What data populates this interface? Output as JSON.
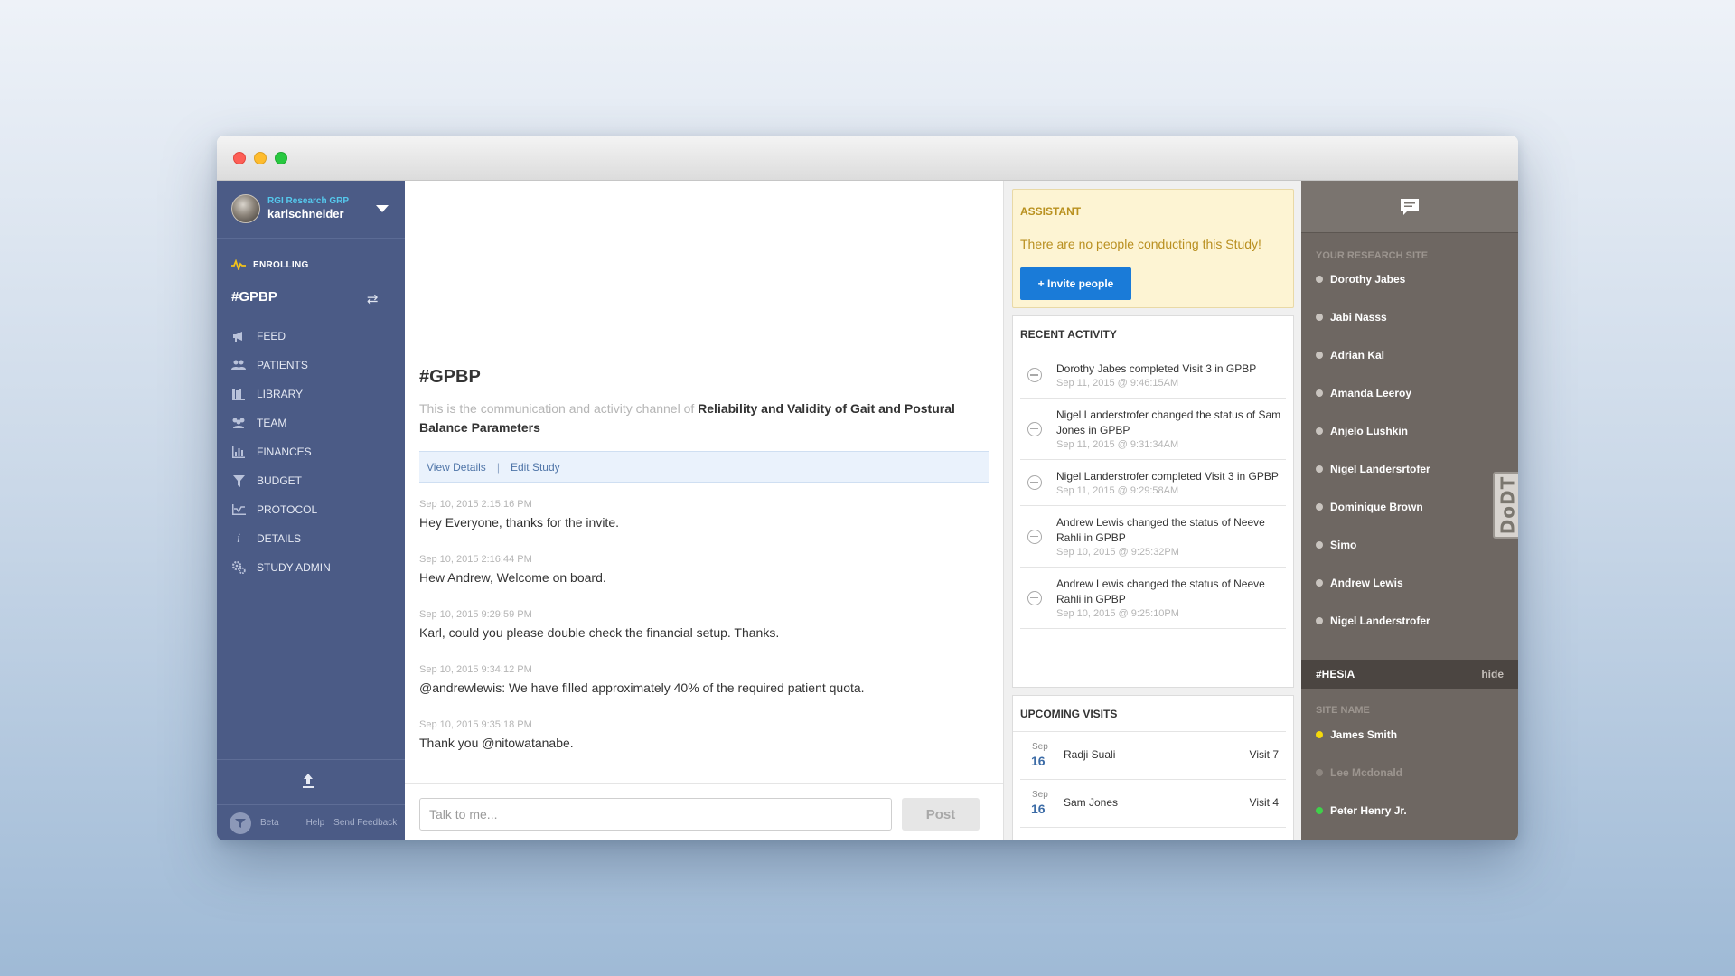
{
  "sidebar": {
    "org": "RGI Research GRP",
    "user": "karlschneider",
    "status": "ENROLLING",
    "channel": "#GPBP",
    "nav": [
      {
        "label": "FEED",
        "icon": "megaphone-icon"
      },
      {
        "label": "PATIENTS",
        "icon": "patients-icon"
      },
      {
        "label": "LIBRARY",
        "icon": "library-icon"
      },
      {
        "label": "TEAM",
        "icon": "team-icon"
      },
      {
        "label": "FINANCES",
        "icon": "bar-chart-icon"
      },
      {
        "label": "BUDGET",
        "icon": "funnel-icon"
      },
      {
        "label": "PROTOCOL",
        "icon": "protocol-icon"
      },
      {
        "label": "DETAILS",
        "icon": "info-icon"
      },
      {
        "label": "STUDY ADMIN",
        "icon": "gears-icon"
      }
    ],
    "bottom": {
      "beta": "Beta",
      "help": "Help",
      "feedback": "Send Feedback"
    }
  },
  "main": {
    "title": "#GPBP",
    "desc_prefix": "This is the communication and activity channel of ",
    "desc_study": "Reliability and Validity of Gait and Postural Balance Parameters",
    "links": {
      "view": "View Details",
      "sep": "|",
      "edit": "Edit Study"
    },
    "messages": [
      {
        "time": "Sep 10, 2015 2:15:16 PM",
        "text": "Hey Everyone, thanks for the invite."
      },
      {
        "time": "Sep 10, 2015 2:16:44 PM",
        "text": "Hew Andrew, Welcome on board."
      },
      {
        "time": "Sep 10, 2015 9:29:59 PM",
        "text": "Karl, could you please double check the financial setup. Thanks."
      },
      {
        "time": "Sep 10, 2015 9:34:12 PM",
        "text": "@andrewlewis: We have filled approximately 40% of the required patient quota."
      },
      {
        "time": "Sep 10, 2015 9:35:18 PM",
        "text": "Thank you @nitowatanabe."
      }
    ],
    "composer": {
      "placeholder": "Talk to me...",
      "post": "Post"
    }
  },
  "assistant": {
    "header": "ASSISTANT",
    "message": "There are no people conducting this Study!",
    "invite": "+ Invite people"
  },
  "activity": {
    "header": "RECENT ACTIVITY",
    "items": [
      {
        "text": "Dorothy Jabes completed Visit 3 in GPBP",
        "time": "Sep 11, 2015 @ 9:46:15AM"
      },
      {
        "text": "Nigel Landerstrofer changed the status of Sam Jones in GPBP",
        "time": "Sep 11, 2015 @ 9:31:34AM"
      },
      {
        "text": "Nigel Landerstrofer completed Visit 3 in GPBP",
        "time": "Sep 11, 2015 @ 9:29:58AM"
      },
      {
        "text": "Andrew Lewis changed the status of Neeve Rahli in GPBP",
        "time": "Sep 10, 2015 @ 9:25:32PM"
      },
      {
        "text": "Andrew Lewis changed the status of Neeve Rahli in GPBP",
        "time": "Sep 10, 2015 @ 9:25:10PM"
      }
    ]
  },
  "visits": {
    "header": "UPCOMING VISITS",
    "items": [
      {
        "month": "Sep",
        "day": "16",
        "name": "Radji Suali",
        "visit": "Visit 7"
      },
      {
        "month": "Sep",
        "day": "16",
        "name": "Sam Jones",
        "visit": "Visit 4"
      }
    ]
  },
  "people": {
    "section1": "YOUR RESEARCH SITE",
    "site1": [
      "Dorothy Jabes",
      "Jabi Nasss",
      "Adrian Kal",
      "Amanda Leeroy",
      "Anjelo Lushkin",
      "Nigel Landersrtofer",
      "Dominique Brown",
      "Simo",
      "Andrew Lewis",
      "Nigel Landerstrofer"
    ],
    "channel": "#HESIA",
    "hide": "hide",
    "section2": "SITE NAME",
    "site2": [
      {
        "name": "James Smith",
        "status_color": "#f5d90a"
      },
      {
        "name": "Lee Mcdonald",
        "status_color": "#8d8680"
      },
      {
        "name": "Peter Henry Jr.",
        "status_color": "#3fd04a"
      }
    ],
    "badge": "DoDT"
  }
}
